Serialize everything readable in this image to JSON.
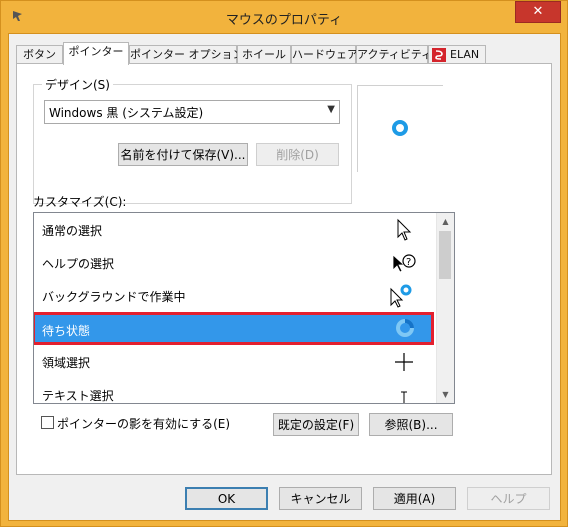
{
  "window": {
    "title": "マウスのプロパティ",
    "close_label": "✕"
  },
  "tabs": [
    {
      "label": "ボタン",
      "active": false
    },
    {
      "label": "ポインター",
      "active": true
    },
    {
      "label": "ポインター オプション",
      "active": false
    },
    {
      "label": "ホイール",
      "active": false
    },
    {
      "label": "ハードウェア",
      "active": false
    },
    {
      "label": "アクティビティ",
      "active": false
    },
    {
      "label": "ELAN",
      "active": false
    }
  ],
  "design": {
    "legend": "デザイン(S)",
    "scheme_value": "Windows 黒 (システム設定)",
    "save_as_label": "名前を付けて保存(V)...",
    "delete_label": "削除(D)"
  },
  "customize": {
    "label": "カスタマイズ(C):",
    "items": [
      {
        "label": "通常の選択",
        "icon": "arrow-cursor-icon"
      },
      {
        "label": "ヘルプの選択",
        "icon": "help-cursor-icon"
      },
      {
        "label": "バックグラウンドで作業中",
        "icon": "working-background-cursor-icon"
      },
      {
        "label": "待ち状態",
        "icon": "busy-cursor-icon",
        "selected": true
      },
      {
        "label": "領域選択",
        "icon": "crosshair-cursor-icon"
      },
      {
        "label": "テキスト選択",
        "icon": "text-cursor-icon"
      }
    ]
  },
  "shadow_checkbox": {
    "label": "ポインターの影を有効にする(E)",
    "checked": false
  },
  "use_default_label": "既定の設定(F)",
  "browse_label": "参照(B)...",
  "footer": {
    "ok_label": "OK",
    "cancel_label": "キャンセル",
    "apply_label": "適用(A)",
    "help_label": "ヘルプ"
  },
  "colors": {
    "titlebar": "#f2b33d",
    "selection": "#3397ea",
    "highlight_border": "#e3202f",
    "busy_ring": "#1e9be6"
  }
}
